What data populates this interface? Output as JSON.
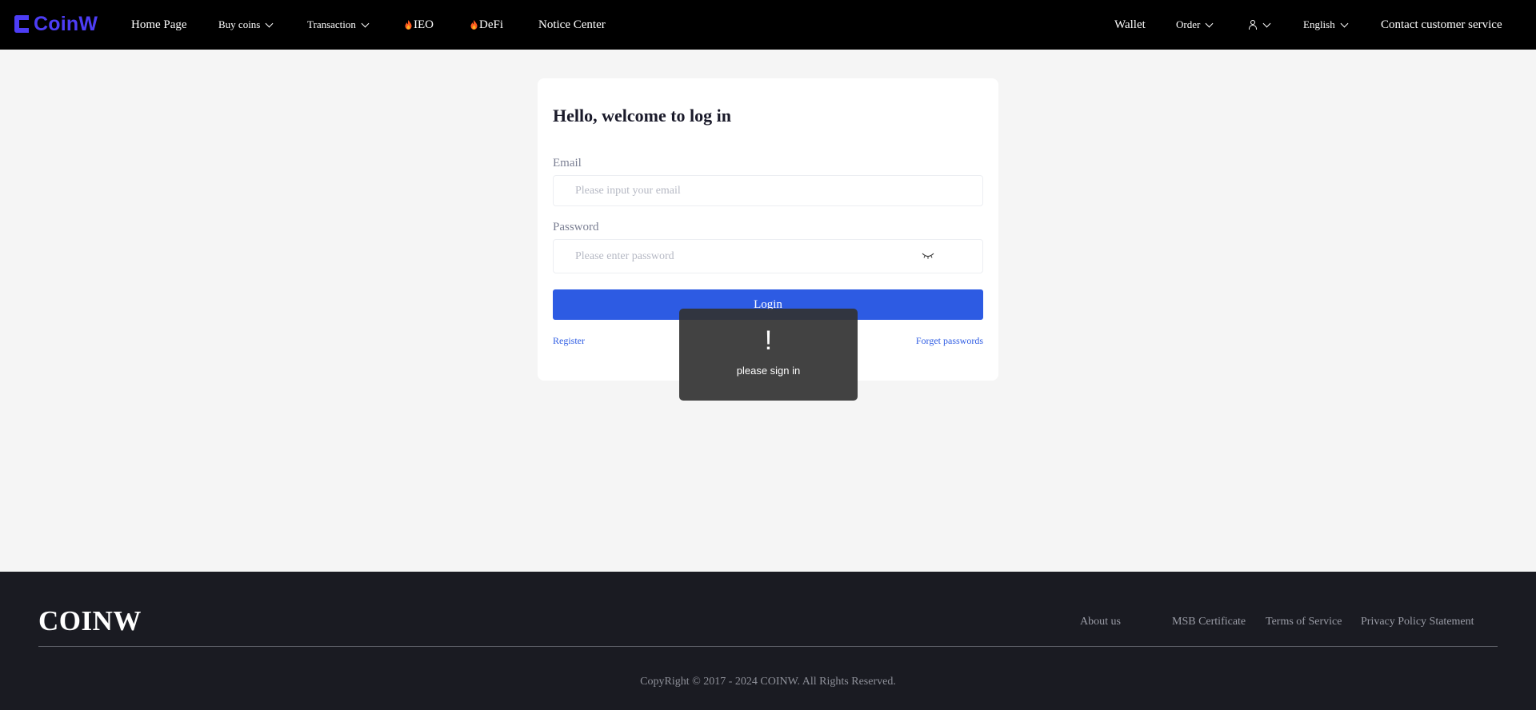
{
  "header": {
    "logo_text": "CoinW",
    "nav": {
      "home": "Home Page",
      "buy_coins": "Buy coins",
      "transaction": "Transaction",
      "ieo": "IEO",
      "defi": "DeFi",
      "notice": "Notice Center"
    },
    "right": {
      "wallet": "Wallet",
      "order": "Order",
      "language": "English",
      "contact": "Contact customer service"
    }
  },
  "login": {
    "title": "Hello, welcome to log in",
    "email_label": "Email",
    "email_placeholder": "Please input your email",
    "email_value": "",
    "password_label": "Password",
    "password_placeholder": "Please enter password",
    "password_value": "",
    "button": "Login",
    "register": "Register",
    "forget": "Forget passwords"
  },
  "toast": {
    "icon": "!",
    "message": "please sign in"
  },
  "footer": {
    "logo": "COINW",
    "links": {
      "about": "About us",
      "msb": "MSB Certificate",
      "terms": "Terms of Service",
      "privacy": "Privacy Policy Statement"
    },
    "copyright": "CopyRight © 2017 - 2024 COINW. All Rights Reserved."
  },
  "colors": {
    "brand": "#4d3df5",
    "primary_button": "#2d5be3",
    "header_bg": "#000000",
    "footer_bg": "#1a1b22",
    "page_bg": "#f5f5f5",
    "flame": "#ff5a1f"
  },
  "icons": {
    "logo": "coinw-logo-icon",
    "flame": "flame-icon",
    "chevron": "chevron-down-icon",
    "user": "user-icon",
    "eye": "eye-closed-icon"
  }
}
